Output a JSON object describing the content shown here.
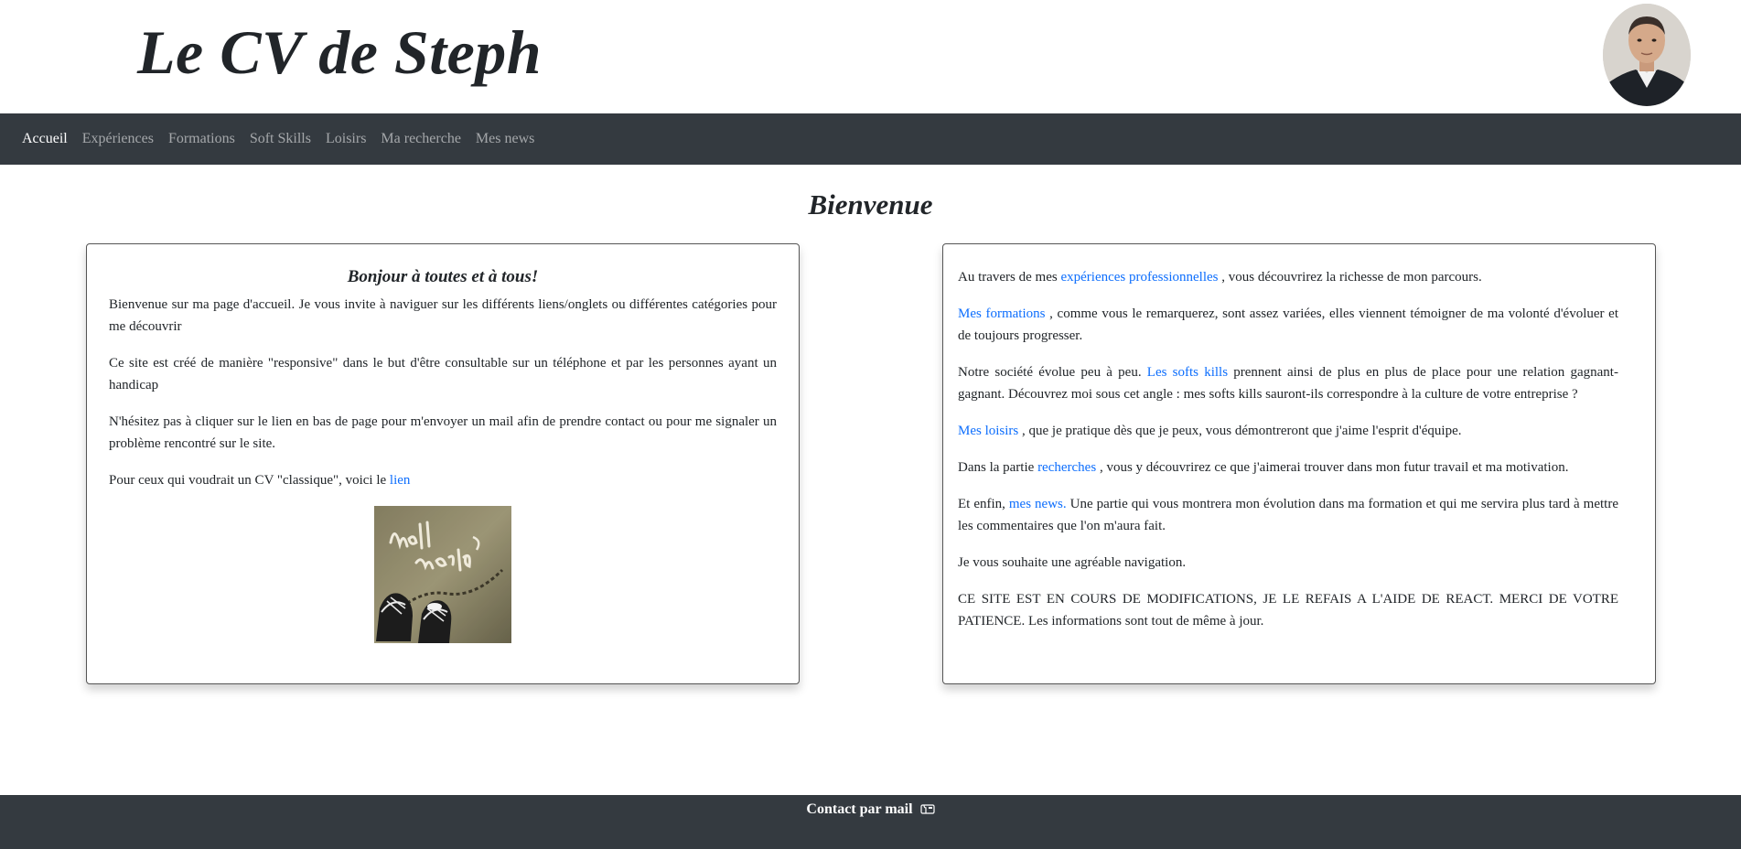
{
  "header": {
    "title": "Le CV de Steph"
  },
  "nav": {
    "items": [
      "Accueil",
      "Expériences",
      "Formations",
      "Soft Skills",
      "Loisirs",
      "Ma recherche",
      "Mes news"
    ],
    "active": "Accueil"
  },
  "main": {
    "heading": "Bienvenue",
    "left_card": {
      "title": "Bonjour à toutes et à tous!",
      "p1": "Bienvenue sur ma page d'accueil. Je vous invite à naviguer sur les différents liens/onglets ou différentes catégories pour me découvrir",
      "p2": "Ce site est créé de manière \"responsive\" dans le but d'être consultable sur un téléphone et par les personnes ayant un handicap",
      "p3": "N'hésitez pas à cliquer sur le lien en bas de page pour m'envoyer un mail afin de prendre contact ou pour me signaler un problème rencontré sur le site.",
      "p4_text": "Pour ceux qui voudrait un CV \"classique\", voici le ",
      "p4_link": "lien"
    },
    "right_card": {
      "p1_before": "Au travers de mes ",
      "p1_link": "expériences professionnelles",
      "p1_after": " , vous découvrirez la richesse de mon parcours.",
      "p2_link": "Mes formations",
      "p2_after": " , comme vous le remarquerez, sont assez variées, elles viennent témoigner de ma volonté d'évoluer et de toujours progresser.",
      "p3_before": "Notre société évolue peu à peu. ",
      "p3_link": "Les softs kills",
      "p3_after": " prennent ainsi de plus en plus de place pour une relation gagnant-gagnant. Découvrez moi sous cet angle : mes softs kills sauront-ils correspondre à la culture de votre entreprise ?",
      "p4_link": "Mes loisirs",
      "p4_after": " , que je pratique dès que je peux, vous démontreront que j'aime l'esprit d'équipe.",
      "p5_before": "Dans la partie ",
      "p5_link": "recherches",
      "p5_after": " , vous y découvrirez ce que j'aimerai trouver dans mon futur travail et ma motivation.",
      "p6_before": "Et enfin, ",
      "p6_link": "mes news.",
      "p6_after": " Une partie qui vous montrera mon évolution dans ma formation et qui me servira plus tard à mettre les commentaires que l'on m'aura fait.",
      "p7": "Je vous souhaite une agréable navigation.",
      "p8": "CE SITE EST EN COURS DE MODIFICATIONS, JE LE REFAIS A L'AIDE DE REACT. MERCI DE VOTRE PATIENCE. Les informations sont tout de même à jour."
    }
  },
  "footer": {
    "contact_label": "Contact par mail"
  },
  "colors": {
    "nav_bg": "#343a40",
    "link": "#0d6efd"
  }
}
